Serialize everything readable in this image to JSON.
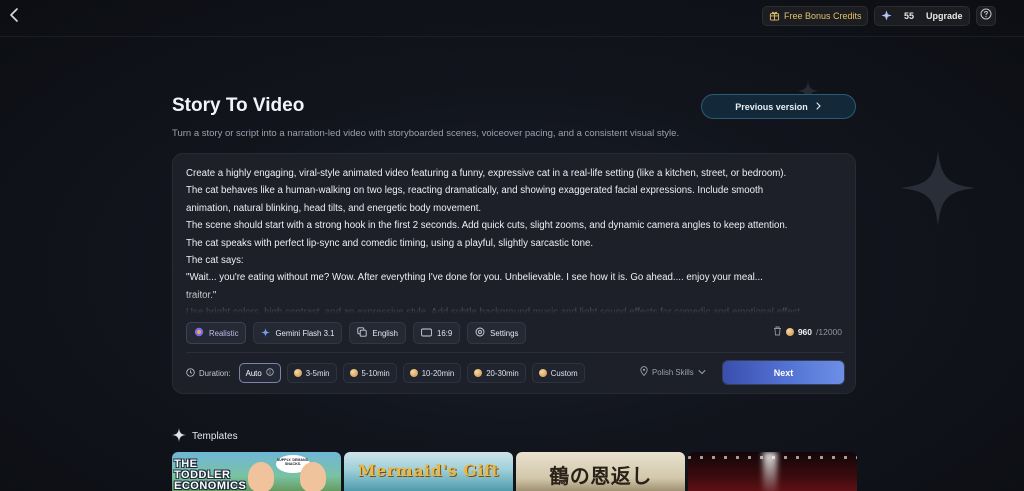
{
  "topbar": {
    "bonus_label": "Free Bonus Credits",
    "credits": "55",
    "upgrade_label": "Upgrade"
  },
  "header": {
    "title": "Story To Video",
    "subtitle": "Turn a story or script into a narration-led video with storyboarded scenes, voiceover pacing, and a consistent visual style.",
    "previous_version_label": "Previous version"
  },
  "prompt": {
    "lines": [
      "Create a highly engaging, viral-style animated video featuring a funny, expressive cat in a real-life setting (like a kitchen, street, or bedroom).",
      "The cat behaves like a human-walking on two legs, reacting dramatically, and showing exaggerated facial expressions. Include smooth",
      "animation, natural blinking, head tilts, and energetic body movement.",
      "The scene should start with a strong hook in the first 2 seconds. Add quick cuts, slight zooms, and dynamic camera angles to keep attention.",
      "The cat speaks with perfect lip-sync and comedic timing, using a playful, slightly sarcastic tone.",
      "The cat says:",
      "\"Wait... you're eating without me? Wow. After everything I've done for you. Unbelievable. I see how it is. Go ahead.... enjoy your meal...",
      "traitor.\"",
      "Use bright colors, high contrast, and an expressive style. Add subtle background music and light sound effects for comedic and emotional effect."
    ]
  },
  "options": {
    "style": "Realistic",
    "model": "Gemini Flash 3.1",
    "language": "English",
    "aspect": "16:9",
    "settings": "Settings"
  },
  "cost": {
    "value": "960",
    "total": "/12000"
  },
  "duration": {
    "label": "Duration:",
    "options": [
      "Auto",
      "3-5min",
      "5-10min",
      "10-20min",
      "20-30min",
      "Custom"
    ],
    "selected": "Auto"
  },
  "polish_label": "Polish Skills",
  "next_label": "Next",
  "templates": {
    "heading": "Templates",
    "items": [
      {
        "title": "THE TODDLER ECONOMICS",
        "bubble": "SUPPLY. DEMAND. SNACKS."
      },
      {
        "title": "Mermaid's Gift"
      },
      {
        "title": "鶴の恩返し"
      },
      {
        "title": ""
      }
    ]
  },
  "colors": {
    "accent": "#5474d4",
    "bonus_gold": "#e4c06c",
    "card_bg": "#1d2029",
    "page_bg": "#12151d"
  }
}
